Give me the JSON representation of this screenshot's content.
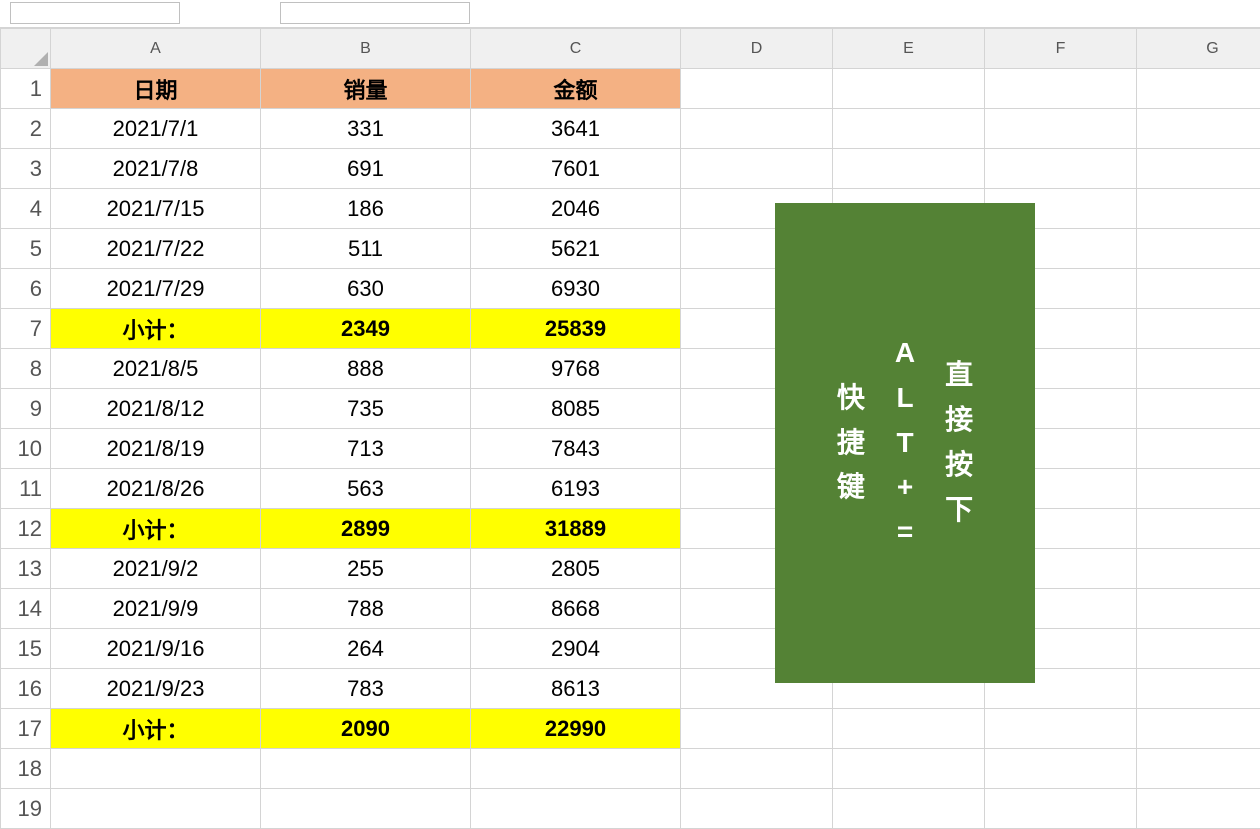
{
  "columns": [
    "A",
    "B",
    "C",
    "D",
    "E",
    "F",
    "G"
  ],
  "header": {
    "A": "日期",
    "B": "销量",
    "C": "金额"
  },
  "rows": [
    {
      "r": 2,
      "A": "2021/7/1",
      "B": "331",
      "C": "3641"
    },
    {
      "r": 3,
      "A": "2021/7/8",
      "B": "691",
      "C": "7601"
    },
    {
      "r": 4,
      "A": "2021/7/15",
      "B": "186",
      "C": "2046"
    },
    {
      "r": 5,
      "A": "2021/7/22",
      "B": "511",
      "C": "5621"
    },
    {
      "r": 6,
      "A": "2021/7/29",
      "B": "630",
      "C": "6930"
    },
    {
      "r": 7,
      "A": "小计：",
      "B": "2349",
      "C": "25839",
      "subtotal": true
    },
    {
      "r": 8,
      "A": "2021/8/5",
      "B": "888",
      "C": "9768"
    },
    {
      "r": 9,
      "A": "2021/8/12",
      "B": "735",
      "C": "8085"
    },
    {
      "r": 10,
      "A": "2021/8/19",
      "B": "713",
      "C": "7843"
    },
    {
      "r": 11,
      "A": "2021/8/26",
      "B": "563",
      "C": "6193"
    },
    {
      "r": 12,
      "A": "小计：",
      "B": "2899",
      "C": "31889",
      "subtotal": true
    },
    {
      "r": 13,
      "A": "2021/9/2",
      "B": "255",
      "C": "2805"
    },
    {
      "r": 14,
      "A": "2021/9/9",
      "B": "788",
      "C": "8668"
    },
    {
      "r": 15,
      "A": "2021/9/16",
      "B": "264",
      "C": "2904"
    },
    {
      "r": 16,
      "A": "2021/9/23",
      "B": "783",
      "C": "8613"
    },
    {
      "r": 17,
      "A": "小计：",
      "B": "2090",
      "C": "22990",
      "subtotal": true
    },
    {
      "r": 18,
      "A": "",
      "B": "",
      "C": ""
    },
    {
      "r": 19,
      "A": "",
      "B": "",
      "C": ""
    }
  ],
  "callout": {
    "col1": "快捷键",
    "col2_chars": [
      "A",
      "L",
      "T",
      "+",
      "="
    ],
    "col3": "直接按下"
  }
}
